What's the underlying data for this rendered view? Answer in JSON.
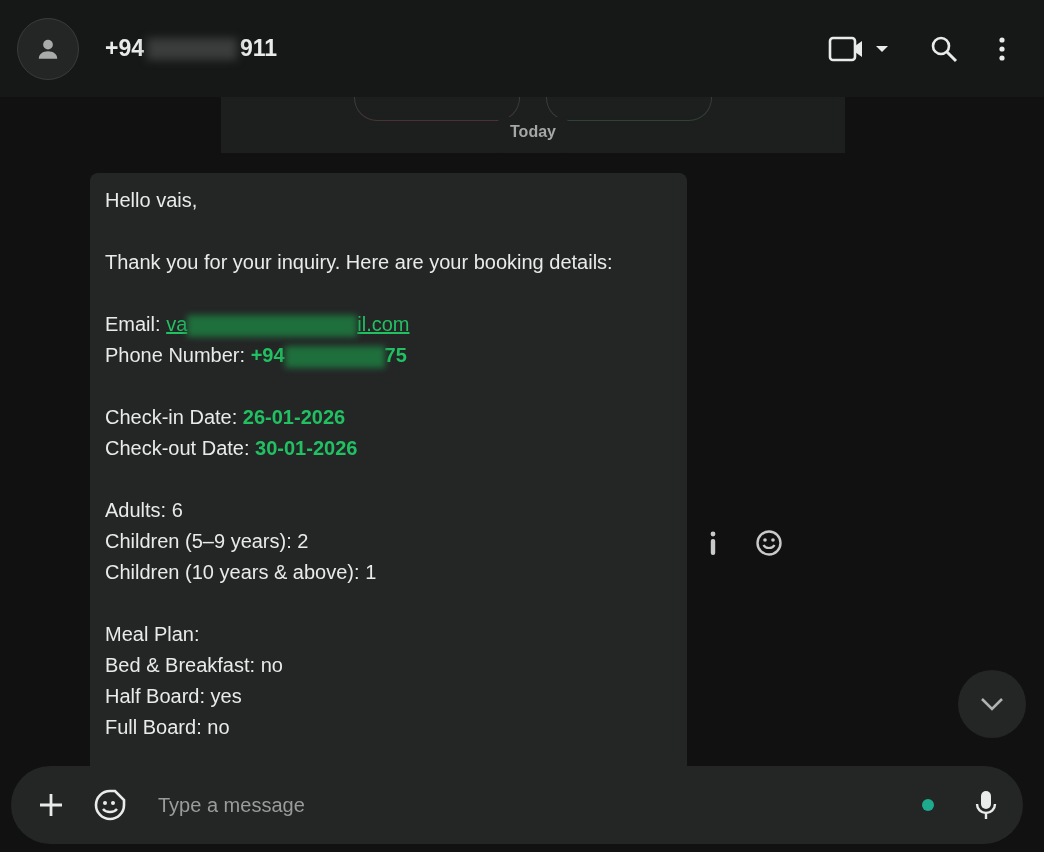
{
  "header": {
    "title_start": "+94",
    "title_end": "911"
  },
  "info_card": {
    "buttons": [
      {
        "kind": "danger"
      },
      {
        "kind": "profile"
      }
    ]
  },
  "date_divider": "Today",
  "message": {
    "paragraphs": [
      [
        {
          "kind": "plain",
          "text": "Hello vais,"
        }
      ],
      [
        {
          "kind": "plain",
          "text": "Thank you for your inquiry. Here are your booking details:"
        }
      ],
      [
        {
          "kind": "redacted-link",
          "label": "Email:",
          "value_start": "va",
          "value_end": "il.com"
        },
        {
          "kind": "redacted-highlight",
          "label": "Phone Number:",
          "value_start": "+94",
          "value_end": "75"
        }
      ],
      [
        {
          "kind": "highlight",
          "label": "Check-in Date:",
          "value": "26-01-2026"
        },
        {
          "kind": "highlight",
          "label": "Check-out Date:",
          "value": "30-01-2026"
        }
      ],
      [
        {
          "kind": "plain",
          "text": "Adults: 6"
        },
        {
          "kind": "plain",
          "text": "Children (5–9 years): 2"
        },
        {
          "kind": "plain",
          "text": "Children (10 years & above): 1"
        }
      ],
      [
        {
          "kind": "plain",
          "text": "Meal Plan:"
        },
        {
          "kind": "plain",
          "text": "Bed & Breakfast: no"
        },
        {
          "kind": "plain",
          "text": "Half Board: yes"
        },
        {
          "kind": "plain",
          "text": "Full Board: no"
        }
      ]
    ]
  },
  "composer": {
    "placeholder": "Type a message"
  }
}
